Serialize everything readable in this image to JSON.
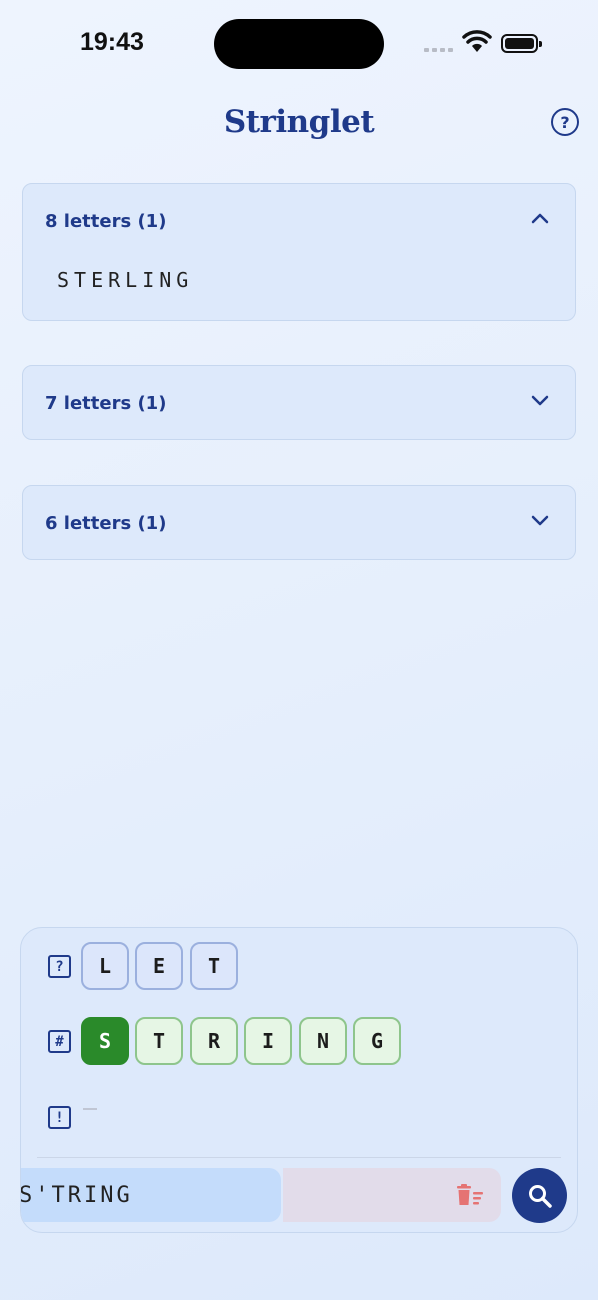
{
  "status_bar": {
    "time": "19:43"
  },
  "header": {
    "title": "Stringlet",
    "help_label": "?"
  },
  "results": [
    {
      "label": "8 letters (1)",
      "expanded": true,
      "words": [
        "STERLING"
      ]
    },
    {
      "label": "7 letters (1)",
      "expanded": false,
      "words": []
    },
    {
      "label": "6 letters (1)",
      "expanded": false,
      "words": []
    }
  ],
  "rows": {
    "unknown": {
      "icon": "?",
      "letters": [
        "L",
        "E",
        "T"
      ]
    },
    "known": {
      "icon": "#",
      "fixed_letter": "S",
      "letters": [
        "T",
        "R",
        "I",
        "N",
        "G"
      ]
    },
    "excluded": {
      "icon": "!",
      "empty_text": "—"
    }
  },
  "input": {
    "value": "S'TRING"
  },
  "icons": [
    "help-icon",
    "chevron-up-icon",
    "chevron-down-icon",
    "trash-icon",
    "search-icon"
  ],
  "colors": {
    "accent": "#1f3a8a",
    "fixed": "#2a8a2a",
    "delete": "#e57373"
  }
}
